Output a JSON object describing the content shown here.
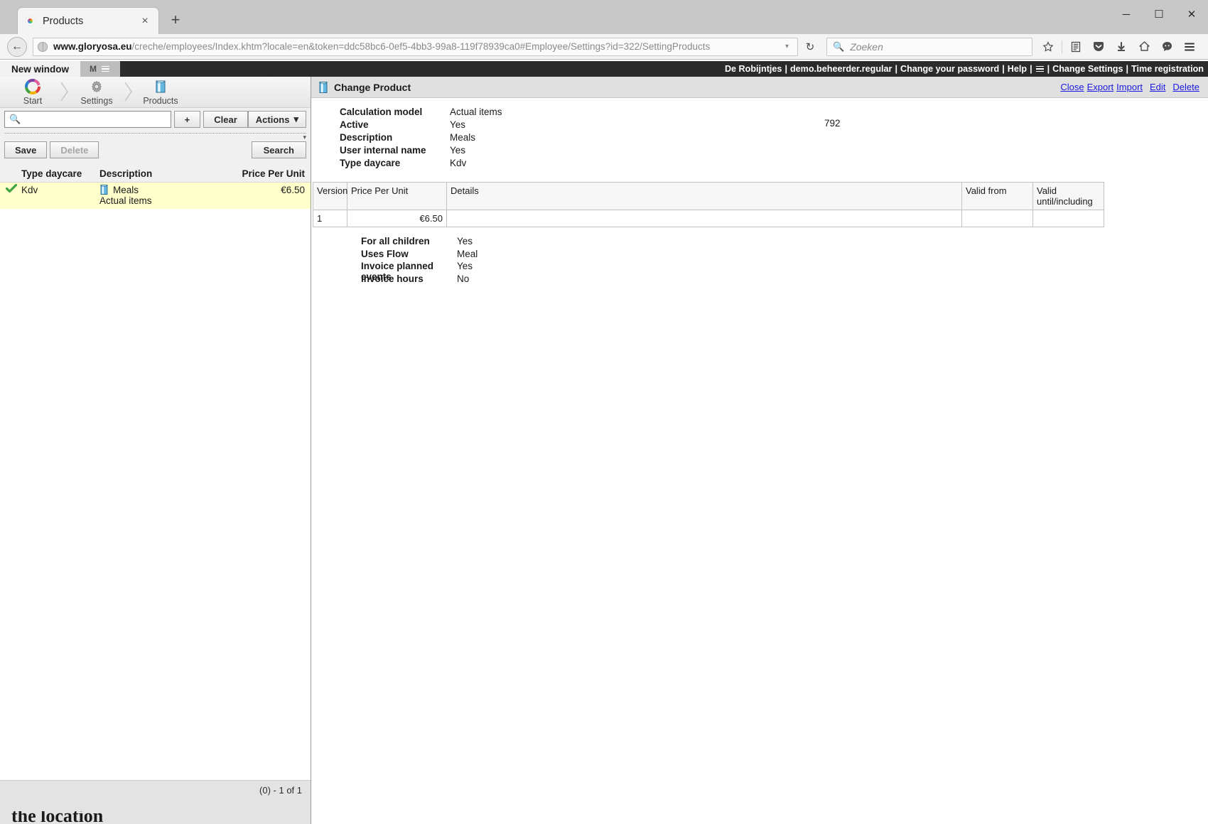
{
  "browser": {
    "tab": {
      "title": "Products",
      "favicon": "colorwheel-icon",
      "close": "×"
    },
    "new_tab": "+",
    "window_controls": {
      "minimize": "─",
      "maximize": "☐",
      "close": "✕"
    },
    "back": "←",
    "reload": "↻",
    "url_parts": {
      "domain": "www.gloryosa.eu",
      "path": "/creche/employees/Index.khtm?locale=en&token=ddc58bc6-0ef5-4bb3-99a8-119f78939ca0#Employee/Settings?id=322/SettingProducts",
      "full": "www.gloryosa.eu/creche/employees/Index.khtm?locale=en&token=ddc58bc6-0ef5-4bb3-99a8-119f78939ca0#Employee/Settings?id=322/SettingProducts"
    },
    "url_dropdown": "▾",
    "search": {
      "placeholder": "Zoeken",
      "icon": "search-icon"
    },
    "toolbar_icons": [
      "bookmark-star-icon",
      "library-icon",
      "pocket-icon",
      "downloads-icon",
      "home-icon",
      "sync-avatar-icon",
      "menu-hamburger-icon"
    ]
  },
  "appbar": {
    "new_window": "New window",
    "m_tab": "M",
    "m_tab_icon": "list-icon",
    "links": [
      "De Robijntjes",
      "demo.beheerder.regular",
      "Change your password",
      "Help",
      "Change Settings",
      "Time registration"
    ],
    "separator": "|",
    "menu_icon": "hamburger-icon"
  },
  "breadcrumb": {
    "items": [
      {
        "label": "Start",
        "icon": "color-wheel-icon"
      },
      {
        "label": "Settings",
        "icon": "gear-icon"
      },
      {
        "label": "Products",
        "icon": "product-box-icon"
      }
    ],
    "arrow": "›"
  },
  "search_panel": {
    "input_value": "",
    "input_placeholder": "",
    "search_icon": "search-icon",
    "add_button": "+",
    "clear_button": "Clear",
    "actions_button": "Actions",
    "actions_caret": "▾",
    "collapse_caret": "▾",
    "save_button": "Save",
    "delete_button": "Delete",
    "search_button": "Search"
  },
  "list": {
    "columns": [
      "Type daycare",
      "Description",
      "Price Per Unit"
    ],
    "rows": [
      {
        "selected_icon": "green-check-icon",
        "type_daycare": "Kdv",
        "description": "Meals",
        "description_icon": "product-box-icon",
        "sub_description": "Actual items",
        "price_per_unit": "€6.50"
      }
    ],
    "footer_count": "(0) - 1 of 1"
  },
  "detail": {
    "title": "Change Product",
    "title_icon": "product-box-icon",
    "links": [
      "Close",
      "Export",
      "Import",
      "Edit",
      "Delete"
    ],
    "fields": [
      {
        "label": "Calculation model",
        "value": "Actual items"
      },
      {
        "label": "Active",
        "value": "Yes"
      },
      {
        "label": "Description",
        "value": "Meals"
      },
      {
        "label": "User internal name",
        "value": "Yes"
      },
      {
        "label": "Type daycare",
        "value": "Kdv"
      }
    ],
    "product_number": "792",
    "version_table": {
      "headers": [
        "Version",
        "Price Per Unit",
        "Details",
        "Valid from",
        "Valid until/including"
      ],
      "rows": [
        {
          "version": "1",
          "price_per_unit": "€6.50",
          "details": "",
          "valid_from": "",
          "valid_until": ""
        }
      ]
    },
    "sub_fields": [
      {
        "label": "For all children",
        "value": "Yes"
      },
      {
        "label": "Uses Flow",
        "value": "Meal"
      },
      {
        "label": "Invoice planned events",
        "value": "Yes"
      },
      {
        "label": "Invoice hours",
        "value": "No"
      }
    ]
  },
  "page_bleed": {
    "text": "the location"
  },
  "colors": {
    "appbar_bg": "#2b2b2b",
    "row_highlight": "#ffffcc",
    "link": "#1a1ae0",
    "check_green": "#3fa13f"
  }
}
